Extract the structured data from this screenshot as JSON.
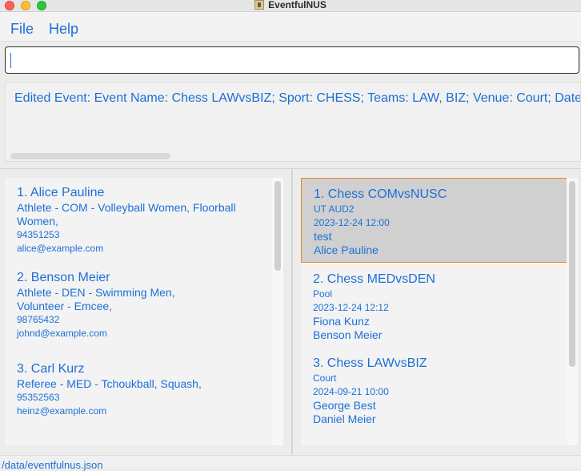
{
  "window": {
    "title": "EventfulNUS"
  },
  "menu": {
    "file": "File",
    "help": "Help"
  },
  "command_box": {
    "value": "",
    "placeholder": ""
  },
  "result": {
    "text": "Edited Event: Event Name: Chess LAWvsBIZ; Sport: CHESS; Teams: LAW, BIZ; Venue: Court; Date"
  },
  "persons": [
    {
      "title": "1. Alice Pauline",
      "roles": [
        "Athlete - COM - Volleyball Women, Floorball",
        "Women,"
      ],
      "phone": "94351253",
      "email": "alice@example.com"
    },
    {
      "title": "2. Benson Meier",
      "roles": [
        "Athlete - DEN - Swimming Men,",
        "Volunteer - Emcee,"
      ],
      "phone": "98765432",
      "email": "johnd@example.com"
    },
    {
      "title": "3. Carl Kurz",
      "roles": [
        "Referee - MED - Tchoukball, Squash,"
      ],
      "phone": "95352563",
      "email": "heinz@example.com"
    }
  ],
  "events": [
    {
      "title": "1. Chess COMvsNUSC",
      "venue": "UT AUD2",
      "datetime": "2023-12-24 12:00",
      "people": [
        "test",
        "Alice Pauline"
      ]
    },
    {
      "title": "2. Chess MEDvsDEN",
      "venue": "Pool",
      "datetime": "2023-12-24 12:12",
      "people": [
        "Fiona Kunz",
        "Benson Meier"
      ]
    },
    {
      "title": "3. Chess LAWvsBIZ",
      "venue": "Court",
      "datetime": "2024-09-21 10:00",
      "people": [
        "George Best",
        "Daniel Meier"
      ]
    }
  ],
  "status": {
    "path": "/data/eventfulnus.json"
  },
  "colors": {
    "accent": "#1d6fd6",
    "selection_border": "#e9832b",
    "selection_bg": "#d0d0d0"
  }
}
